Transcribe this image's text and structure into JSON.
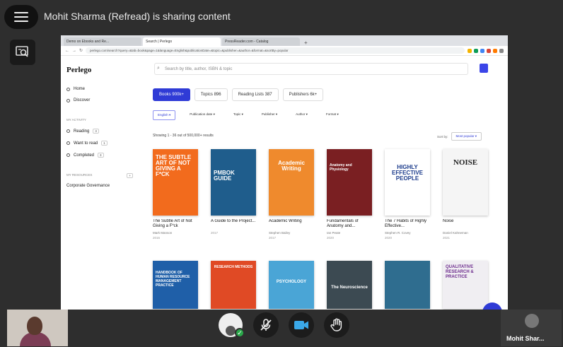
{
  "meeting": {
    "share_title": "Mohit Sharma (Refread) is sharing content",
    "participant_name": "Mohit Shar..."
  },
  "browser": {
    "tabs": [
      {
        "label": "Demo on Ebooks and Re...",
        "active": false
      },
      {
        "label": "Search | Perlego",
        "active": true
      },
      {
        "label": "PressReader.com - Catalog",
        "active": false
      }
    ],
    "url": "perlego.com/search?query=&tab=book&page=1&language=English&publicationDate=&topic=&publisher=&author=&format=&sortBy=popular"
  },
  "app": {
    "logo": "Perlego",
    "search_placeholder": "Search by title, author, ISBN & topic",
    "sidebar": {
      "home": "Home",
      "discover": "Discover",
      "my_activity": "MY ACTIVITY",
      "reading": "Reading",
      "reading_count": "3",
      "want_to_read": "Want to read",
      "want_to_read_count": "1",
      "completed": "Completed",
      "completed_count": "3",
      "my_resources": "MY RESOURCES",
      "corporate": "Corporate Governance"
    },
    "pills": [
      {
        "label": "Books",
        "count": "900k+",
        "active": true
      },
      {
        "label": "Topics",
        "count": "896",
        "active": false
      },
      {
        "label": "Reading Lists",
        "count": "387",
        "active": false
      },
      {
        "label": "Publishers",
        "count": "6k+",
        "active": false
      }
    ],
    "filters": [
      "English",
      "Publication date",
      "Topic",
      "Publisher",
      "Author",
      "Format"
    ],
    "results_text": "Showing 1 - 36 out of 500,000+ results",
    "sort_label": "Sort by:",
    "sort_value": "Most popular",
    "books": [
      {
        "title": "The Subtle Art of Not Giving a F*ck",
        "author": "Mark Manson",
        "year": "2016",
        "cover_color": "#f26b1d",
        "cover_text": "THE SUBTLE ART OF NOT GIVING A F*CK",
        "text_color": "#ffffff"
      },
      {
        "title": "A Guide to the Project...",
        "author": "",
        "year": "2017",
        "cover_color": "#1f5d8c",
        "cover_text": "PMBOK GUIDE",
        "text_color": "#ffffff"
      },
      {
        "title": "Academic Writing",
        "author": "Stephen Bailey",
        "year": "2017",
        "cover_color": "#ef8a2d",
        "cover_text": "Academic Writing",
        "text_color": "#ffffff"
      },
      {
        "title": "Fundamentals of Anatomy and...",
        "author": "Ian Peate",
        "year": "2020",
        "cover_color": "#7a1f22",
        "cover_text": "Anatomy and Physiology",
        "text_color": "#ffffff"
      },
      {
        "title": "The 7 Habits of Highly Effective...",
        "author": "Stephen R. Covey",
        "year": "2020",
        "cover_color": "#ffffff",
        "cover_text": "HIGHLY EFFECTIVE PEOPLE",
        "text_color": "#1c3c8c"
      },
      {
        "title": "Noise",
        "author": "Daniel Kahneman",
        "year": "2021",
        "cover_color": "#f5f5f5",
        "cover_text": "NOISE",
        "text_color": "#222222"
      }
    ],
    "books_row2": [
      {
        "cover_color": "#1f5fa8",
        "cover_text": "HANDBOOK OF HUMAN RESOURCE MANAGEMENT PRACTICE",
        "text_color": "#ffffff"
      },
      {
        "cover_color": "#e04a25",
        "cover_text": "RESEARCH METHODS",
        "text_color": "#ffffff"
      },
      {
        "cover_color": "#4aa5d6",
        "cover_text": "PSYCHOLOGY",
        "text_color": "#ffffff"
      },
      {
        "cover_color": "#3c4a52",
        "cover_text": "The Neuroscience",
        "text_color": "#ffffff"
      },
      {
        "cover_color": "#2f6d8f",
        "cover_text": "",
        "text_color": "#ffffff"
      },
      {
        "cover_color": "#f0eef2",
        "cover_text": "QUALITATIVE RESEARCH & PRACTICE",
        "text_color": "#6b2a8c"
      }
    ]
  },
  "icons": {
    "menu": "hamburger-menu-icon",
    "viewer": "screen-viewer-icon",
    "mic": "microphone-muted-icon",
    "camera": "video-camera-icon",
    "raise_hand": "raise-hand-icon",
    "help": "chat-help-icon"
  },
  "colors": {
    "accent": "#2f3bd6",
    "camera": "#3aa8e8",
    "status_ok": "#2aa84a"
  }
}
